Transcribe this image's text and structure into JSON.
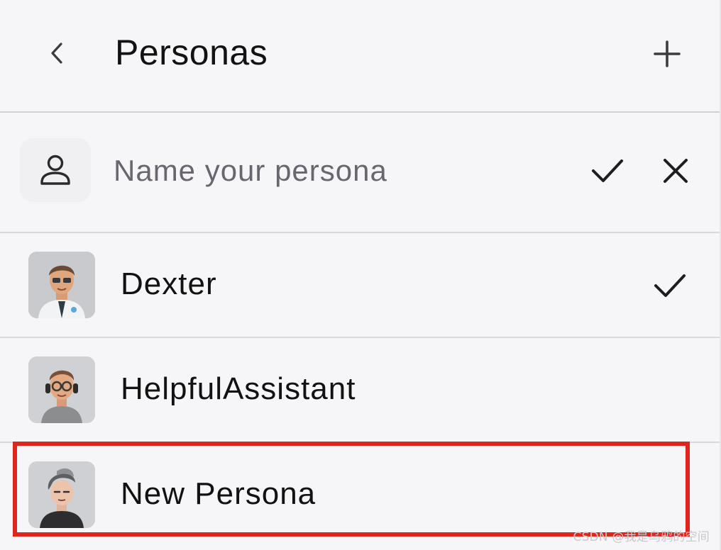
{
  "header": {
    "title": "Personas",
    "back_icon": "chevron-left-icon",
    "add_icon": "plus-icon"
  },
  "name_row": {
    "icon": "person-icon",
    "placeholder": "Name your persona",
    "confirm_icon": "checkmark-icon",
    "cancel_icon": "close-icon"
  },
  "personas": [
    {
      "name": "Dexter",
      "avatar": "avatar-doctor",
      "selected": true
    },
    {
      "name": "HelpfulAssistant",
      "avatar": "avatar-headset",
      "selected": false
    },
    {
      "name": "New Persona",
      "avatar": "avatar-punk",
      "selected": false
    }
  ],
  "highlight": {
    "color": "#e0251c",
    "target": "New Persona"
  },
  "watermark": "CSDN @我是乌鸦的空间"
}
